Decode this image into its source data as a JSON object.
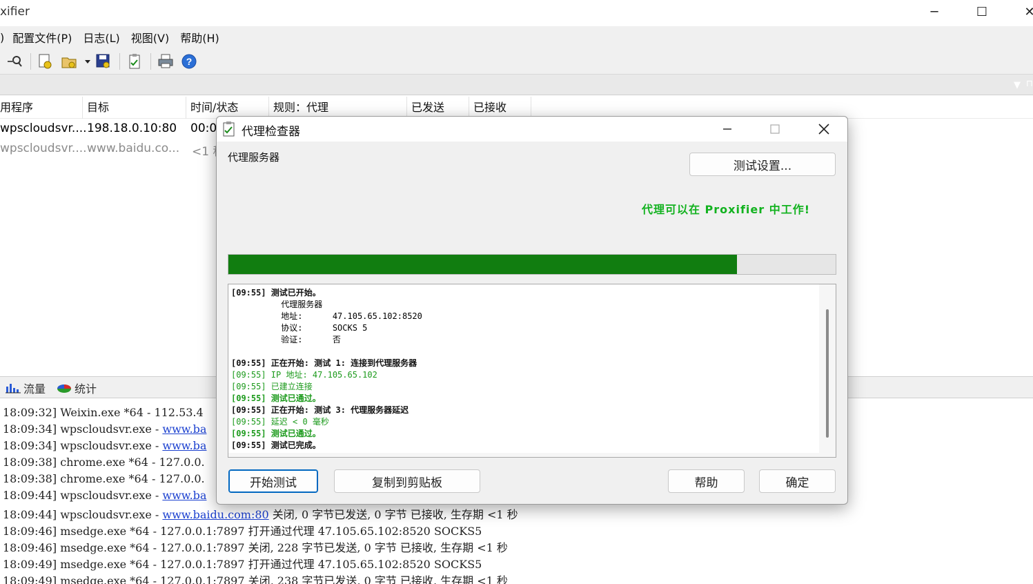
{
  "window": {
    "title": "xifier",
    "min": "─",
    "max": "☐",
    "close": "✕"
  },
  "menu": {
    "items": [
      ")",
      "配置文件(P)",
      "日志(L)",
      "视图(V)",
      "帮助(H)"
    ]
  },
  "connections": {
    "columns": [
      "用程序",
      "目标",
      "时间/状态",
      "规则：代理",
      "已发送",
      "已接收"
    ],
    "rows": [
      {
        "app": "wpscloudsvr....",
        "target": "198.18.0.10:80",
        "time": "00:0"
      },
      {
        "app": "wpscloudsvr....",
        "target": "www.baidu.co...",
        "time": "<1 秒"
      }
    ]
  },
  "tabs": {
    "traffic": "流量",
    "stats": "统计"
  },
  "log": {
    "lines": [
      {
        "time": "18:09:32]",
        "text": "Weixin.exe *64 - 112.53.4",
        "link": "",
        "rest": ""
      },
      {
        "time": "18:09:34]",
        "text": "wpscloudsvr.exe - ",
        "link": "www.ba",
        "rest": ""
      },
      {
        "time": "18:09:34]",
        "text": "wpscloudsvr.exe - ",
        "link": "www.ba",
        "rest": ""
      },
      {
        "time": "18:09:38]",
        "text": "chrome.exe *64 - 127.0.0.",
        "link": "",
        "rest": ""
      },
      {
        "time": "18:09:38]",
        "text": "chrome.exe *64 - 127.0.0.",
        "link": "",
        "rest": ""
      },
      {
        "time": "18:09:44]",
        "text": "wpscloudsvr.exe - ",
        "link": "www.ba",
        "rest": ""
      },
      {
        "time": "18:09:44]",
        "text": "wpscloudsvr.exe - ",
        "link": "www.baidu.com:80",
        "rest": " 关闭, 0 字节已发送, 0 字节 已接收, 生存期 <1 秒"
      },
      {
        "time": "18:09:46]",
        "text": "msedge.exe *64 - 127.0.0.1:7897 打开通过代理 47.105.65.102:8520 SOCKS5",
        "link": "",
        "rest": ""
      },
      {
        "time": "18:09:46]",
        "text": "msedge.exe *64 - 127.0.0.1:7897 关闭, 228 字节已发送, 0 字节 已接收, 生存期 <1 秒",
        "link": "",
        "rest": ""
      },
      {
        "time": "18:09:49]",
        "text": "msedge.exe *64 - 127.0.0.1:7897 打开通过代理 47.105.65.102:8520 SOCKS5",
        "link": "",
        "rest": ""
      },
      {
        "time": "18:09:49]",
        "text": "msedge.exe *64 - 127.0.0.1:7897 关闭, 238 字节已发送, 0 字节 已接收, 生存期 <1 秒",
        "link": "",
        "rest": ""
      }
    ]
  },
  "dialog": {
    "title": "代理检查器",
    "proxy_label": "代理服务器",
    "test_settings_button": "测试设置...",
    "success_message": "代理可以在 Proxifier 中工作!",
    "progress_fraction": 0.838,
    "progress_color": "#117d10",
    "log": [
      {
        "style": "b",
        "text": "[09:55] 测试已开始。"
      },
      {
        "style": "n",
        "text": "          代理服务器"
      },
      {
        "style": "n",
        "text": "          地址:      47.105.65.102:8520"
      },
      {
        "style": "n",
        "text": "          协议:      SOCKS 5"
      },
      {
        "style": "n",
        "text": "          验证:      否"
      },
      {
        "style": "n",
        "text": ""
      },
      {
        "style": "b",
        "text": "[09:55] 正在开始: 测试 1: 连接到代理服务器"
      },
      {
        "style": "g",
        "text": "[09:55] IP 地址: 47.105.65.102"
      },
      {
        "style": "g",
        "text": "[09:55] 已建立连接"
      },
      {
        "style": "gb",
        "text": "[09:55] 测试已通过。"
      },
      {
        "style": "b",
        "text": "[09:55] 正在开始: 测试 3: 代理服务器延迟"
      },
      {
        "style": "g",
        "text": "[09:55] 延迟 < 0 毫秒"
      },
      {
        "style": "gb",
        "text": "[09:55] 测试已通过。"
      },
      {
        "style": "b",
        "text": "[09:55] 测试已完成。"
      }
    ],
    "buttons": {
      "start": "开始测试",
      "copy": "复制到剪贴板",
      "help": "帮助",
      "ok": "确定"
    }
  }
}
